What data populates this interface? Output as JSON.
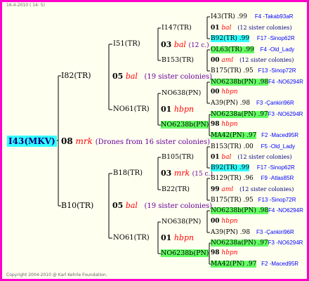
{
  "header_date": "16-4-2010 ( 14: 5)",
  "footer": "Copyright 2004-2010 @ Karl Kehrle Foundation.",
  "root": {
    "label": "I43(MKV)",
    "num": "08",
    "breed": "mrk",
    "note": "(Drones from 16 sister colonies)"
  },
  "g1_top": {
    "label": "I82(TR)",
    "num": "05",
    "breed": "bal",
    "note": "(19 sister colonies)"
  },
  "g1_bot": {
    "label": "B10(TR)",
    "num": "05",
    "breed": "bal",
    "note": "(19 sister colonies)"
  },
  "g2": [
    {
      "label": "I51(TR)",
      "num": "03",
      "breed": "bal",
      "note": "(12 c.)"
    },
    {
      "label": "NO61(TR)",
      "num": "01",
      "breed": "hbpn"
    },
    {
      "label": "B18(TR)",
      "num": "03",
      "breed": "mrk",
      "note": "(15 c.)"
    },
    {
      "label": "NO61(TR)",
      "num": "01",
      "breed": "hbpn"
    }
  ],
  "g3": [
    {
      "label": "I147(TR)"
    },
    {
      "label": "B153(TR)"
    },
    {
      "label": "NO638(PN)"
    },
    {
      "label": "NO6238b(PN)"
    },
    {
      "label": "B105(TR)"
    },
    {
      "label": "B22(TR)"
    },
    {
      "label": "NO638(PN)"
    },
    {
      "label": "NO6238b(PN)"
    }
  ],
  "g4": [
    {
      "a": "I43(TR) .99",
      "b": "F4 -Takab93aR"
    },
    {
      "num": "01",
      "breed": "bal",
      "note": "(12 sister colonies)"
    },
    {
      "a": "B92(TR) .99",
      "b": "F17 -Sinop62R"
    },
    {
      "a": "OL63(TR) .99",
      "b": "F4 -Old_Lady"
    },
    {
      "num": "00",
      "breed": "aml",
      "note": "(12 sister colonies)"
    },
    {
      "a": "B175(TR) .95",
      "b": "F13 -Sinop72R"
    },
    {
      "a": "NO6238b(PN) .98",
      "b": "F4 -NO6294R"
    },
    {
      "num": "00",
      "breed": "hbpn"
    },
    {
      "a": "A39(PN) .98",
      "b": "F3 -Çankiri96R"
    },
    {
      "a": "NO6238a(PN) .97",
      "b": "F3 -NO6294R"
    },
    {
      "num": "98",
      "breed": "hbpn"
    },
    {
      "a": "MA42(PN) .97",
      "b": "F2 -Maced95R"
    },
    {
      "a": "B153(TR) .00",
      "b": "F5 -Old_Lady"
    },
    {
      "num": "01",
      "breed": "bal",
      "note": "(12 sister colonies)"
    },
    {
      "a": "B92(TR) .99",
      "b": "F17 -Sinop62R"
    },
    {
      "a": "B129(TR) .96",
      "b": "F9 -Atlas85R"
    },
    {
      "num": "99",
      "breed": "aml",
      "note": "(12 sister colonies)"
    },
    {
      "a": "B175(TR) .95",
      "b": "F13 -Sinop72R"
    },
    {
      "a": "NO6238b(PN) .98",
      "b": "F4 -NO6294R"
    },
    {
      "num": "00",
      "breed": "hbpn"
    },
    {
      "a": "A39(PN) .98",
      "b": "F3 -Çankiri96R"
    },
    {
      "a": "NO6238a(PN) .97",
      "b": "F3 -NO6294R"
    },
    {
      "num": "98",
      "breed": "hbpn"
    },
    {
      "a": "MA42(PN) .97",
      "b": "F2 -Maced95R"
    }
  ]
}
